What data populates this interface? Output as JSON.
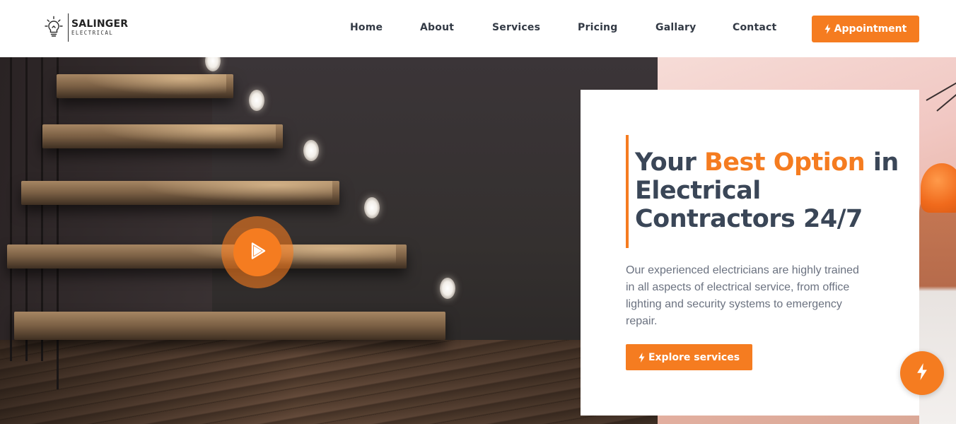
{
  "brand": {
    "name": "SALINGER",
    "subtitle": "ELECTRICAL",
    "logo_icon": "lightbulb-icon"
  },
  "nav": {
    "items": [
      {
        "label": "Home"
      },
      {
        "label": "About"
      },
      {
        "label": "Services"
      },
      {
        "label": "Pricing"
      },
      {
        "label": "Gallary"
      },
      {
        "label": "Contact"
      }
    ],
    "cta_label": "Appointment",
    "cta_icon": "lightning-bolt-icon"
  },
  "hero": {
    "headline_part1": "Your ",
    "headline_accent": "Best Option",
    "headline_part2": " in Electrical Contractors 24/7",
    "description": "Our experienced electricians are highly trained in all aspects of electrical service, from office lighting and security systems to emergency repair.",
    "explore_label": "Explore services",
    "explore_icon": "lightning-bolt-icon",
    "play_icon": "play-icon",
    "fab_icon": "lightning-bolt-icon"
  },
  "colors": {
    "accent": "#f57c20",
    "heading": "#3a4657",
    "body_text": "#6b7280"
  }
}
